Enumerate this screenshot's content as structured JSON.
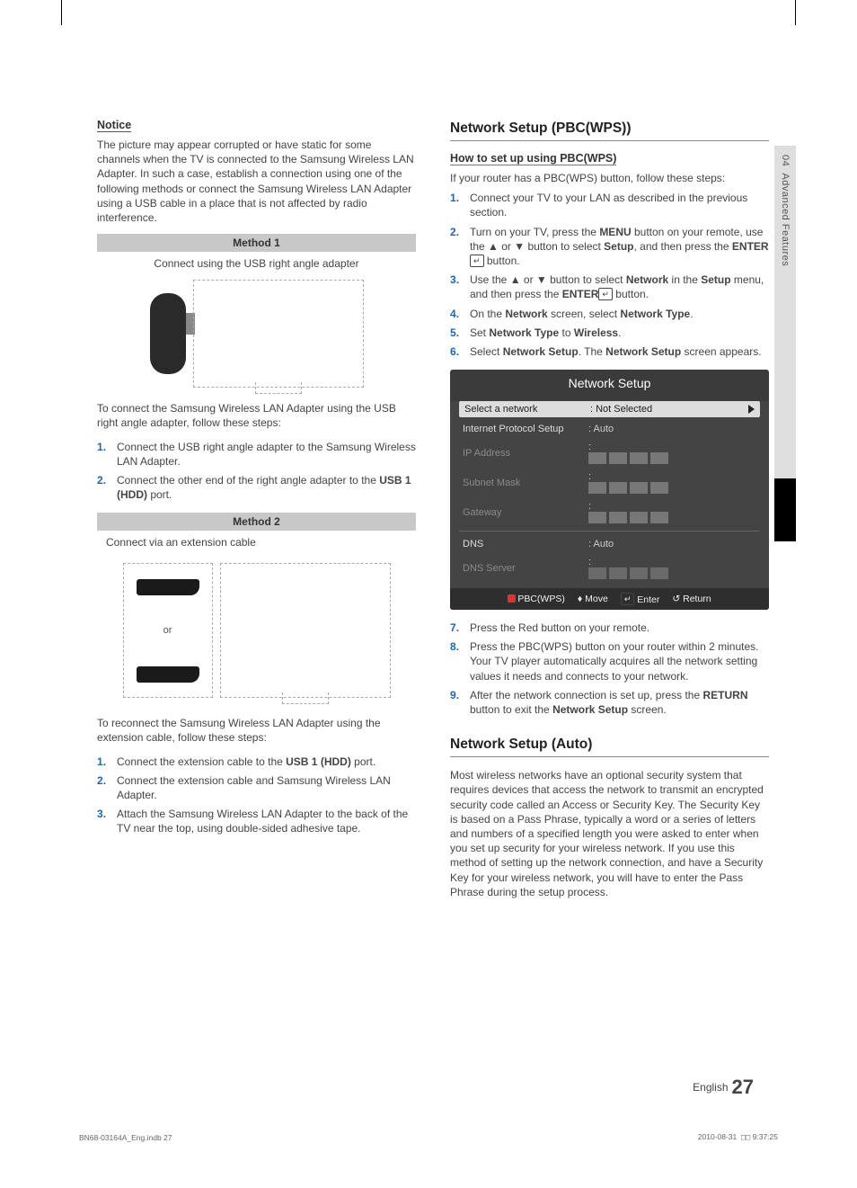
{
  "sidebar": {
    "chapter": "04",
    "title": "Advanced Features"
  },
  "left": {
    "notice_heading": "Notice",
    "notice_para": "The picture may appear corrupted or have static for some channels when the TV is connected to the Samsung Wireless LAN Adapter. In such a case, establish a connection using one of the following methods or connect the Samsung Wireless LAN Adapter using a USB cable in a place that is not affected by radio interference.",
    "m1_title": "Method 1",
    "m1_caption": "Connect using the USB right angle adapter",
    "m1_intro": "To connect the Samsung Wireless LAN Adapter using the USB right angle adapter, follow these steps:",
    "m1_steps": [
      "Connect the USB right angle adapter to the Samsung Wireless LAN Adapter.",
      "Connect the other end of the right angle adapter to the USB 1 (HDD) port."
    ],
    "m2_title": "Method 2",
    "m2_caption": "Connect via an extension cable",
    "m2_or": "or",
    "m2_intro": "To reconnect the Samsung Wireless LAN Adapter using the extension cable, follow these steps:",
    "m2_steps": [
      "Connect the extension cable to the USB 1 (HDD) port.",
      "Connect the extension cable and Samsung Wireless LAN Adapter.",
      "Attach the Samsung Wireless LAN Adapter to the back of the TV near the top, using double-sided adhesive tape."
    ]
  },
  "right": {
    "pbc_title": "Network Setup (PBC(WPS))",
    "pbc_sub": "How to set up using PBC(WPS)",
    "pbc_intro": "If your router has a PBC(WPS) button, follow these steps:",
    "pbc_steps_pre": [
      "Connect your TV to your LAN as described in the previous section.",
      "Turn on your TV, press the MENU button on your remote, use the ▲ or ▼ button to select Setup, and then press the ENTER button.",
      "Use the ▲ or ▼ button to select Network in the Setup menu, and then press the ENTER button.",
      "On the Network screen, select Network Type.",
      "Set Network Type to Wireless.",
      "Select Network Setup. The Network Setup screen appears."
    ],
    "net_box": {
      "title": "Network Setup",
      "rows": {
        "select_net": {
          "label": "Select a network",
          "value": ": Not Selected"
        },
        "ip_setup": {
          "label": "Internet Protocol Setup",
          "value": ": Auto"
        },
        "ip_addr": {
          "label": "IP Address",
          "value": ":"
        },
        "subnet": {
          "label": "Subnet Mask",
          "value": ":"
        },
        "gateway": {
          "label": "Gateway",
          "value": ":"
        },
        "dns": {
          "label": "DNS",
          "value": ": Auto"
        },
        "dns_srv": {
          "label": "DNS Server",
          "value": ":"
        }
      },
      "footer": {
        "pbc": "PBC(WPS)",
        "move": "Move",
        "enter": "Enter",
        "return": "Return"
      }
    },
    "pbc_steps_post": [
      "Press the Red button on your remote.",
      "Press the PBC(WPS) button on your router within 2 minutes. Your TV player automatically acquires all the network setting values it needs and connects to your network.",
      "After the network connection is set up, press the RETURN button to exit the Network Setup screen."
    ],
    "auto_title": "Network Setup (Auto)",
    "auto_para": "Most wireless networks have an optional security system that requires devices that access the network to transmit an encrypted security code called an Access or Security Key. The Security Key is based on a Pass Phrase, typically a word or a series of letters and numbers of a specified length you were asked to enter when you set up security for your wireless network. If you use this method of setting up the network connection, and have a Security Key for your wireless network, you will have to enter the Pass Phrase during the setup process."
  },
  "footer": {
    "lang": "English",
    "page": "27",
    "doc": "BN68-03164A_Eng.indb   27",
    "date": "2010-08-31",
    "time": "9:37:25"
  }
}
